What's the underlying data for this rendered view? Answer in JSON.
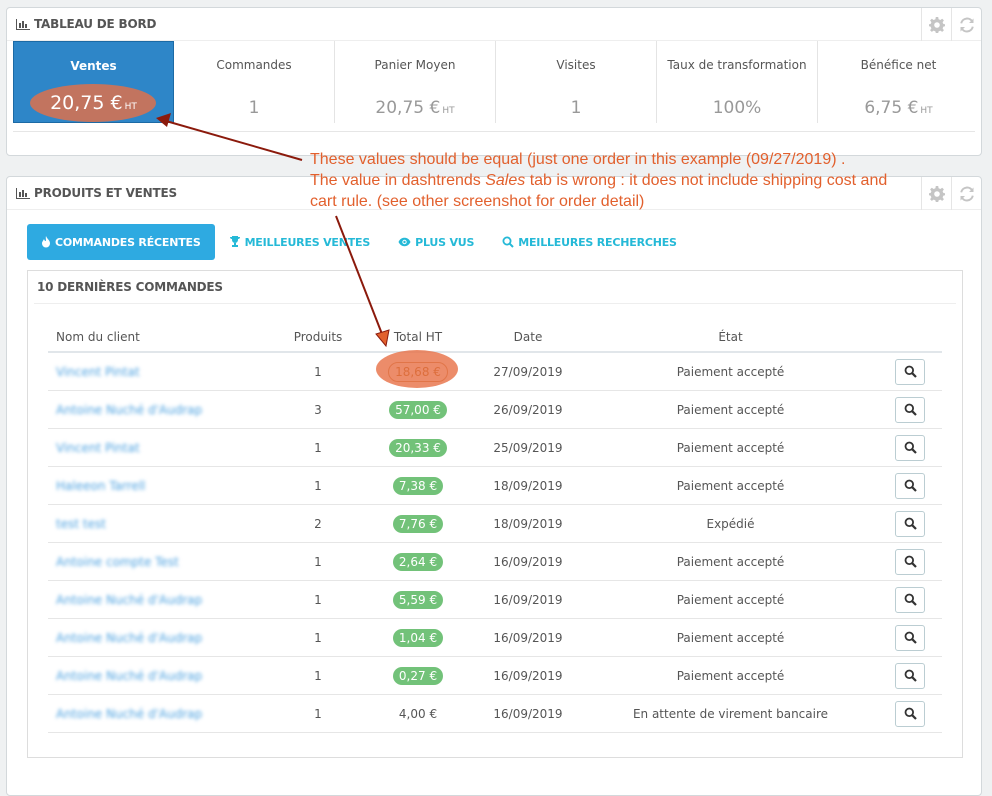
{
  "dashboard": {
    "title": "TABLEAU DE BORD",
    "kpis": [
      {
        "label": "Ventes",
        "value": "20,75 €",
        "unit": "HT",
        "active": true
      },
      {
        "label": "Commandes",
        "value": "1",
        "unit": ""
      },
      {
        "label": "Panier Moyen",
        "value": "20,75 €",
        "unit": "HT"
      },
      {
        "label": "Visites",
        "value": "1",
        "unit": ""
      },
      {
        "label": "Taux de transformation",
        "value": "100%",
        "unit": ""
      },
      {
        "label": "Bénéfice net",
        "value": "6,75 €",
        "unit": "HT"
      }
    ]
  },
  "products": {
    "title": "PRODUITS ET VENTES",
    "tabs": [
      {
        "label": "COMMANDES RÉCENTES",
        "icon": "fire-icon",
        "active": true
      },
      {
        "label": "MEILLEURES VENTES",
        "icon": "trophy-icon"
      },
      {
        "label": "PLUS VUS",
        "icon": "eye-icon"
      },
      {
        "label": "MEILLEURES RECHERCHES",
        "icon": "search-icon"
      }
    ],
    "subpanel_title": "10 DERNIÈRES COMMANDES",
    "columns": [
      "Nom du client",
      "Produits",
      "Total HT",
      "Date",
      "État"
    ],
    "rows": [
      {
        "client": "Vincent Pintat",
        "products": "1",
        "total": "18,68 €",
        "date": "27/09/2019",
        "status": "Paiement accepté",
        "badge": "highlight"
      },
      {
        "client": "Antoine Nuché d'Audrap",
        "products": "3",
        "total": "57,00 €",
        "date": "26/09/2019",
        "status": "Paiement accepté",
        "badge": "green"
      },
      {
        "client": "Vincent Pintat",
        "products": "1",
        "total": "20,33 €",
        "date": "25/09/2019",
        "status": "Paiement accepté",
        "badge": "green"
      },
      {
        "client": "Haleeon Tarrell",
        "products": "1",
        "total": "7,38 €",
        "date": "18/09/2019",
        "status": "Paiement accepté",
        "badge": "green"
      },
      {
        "client": "test test",
        "products": "2",
        "total": "7,76 €",
        "date": "18/09/2019",
        "status": "Expédié",
        "badge": "green"
      },
      {
        "client": "Antoine compte Test",
        "products": "1",
        "total": "2,64 €",
        "date": "16/09/2019",
        "status": "Paiement accepté",
        "badge": "green"
      },
      {
        "client": "Antoine Nuché d'Audrap",
        "products": "1",
        "total": "5,59 €",
        "date": "16/09/2019",
        "status": "Paiement accepté",
        "badge": "green"
      },
      {
        "client": "Antoine Nuché d'Audrap",
        "products": "1",
        "total": "1,04 €",
        "date": "16/09/2019",
        "status": "Paiement accepté",
        "badge": "green"
      },
      {
        "client": "Antoine Nuché d'Audrap",
        "products": "1",
        "total": "0,27 €",
        "date": "16/09/2019",
        "status": "Paiement accepté",
        "badge": "green"
      },
      {
        "client": "Antoine Nuché d'Audrap",
        "products": "1",
        "total": "4,00 €",
        "date": "16/09/2019",
        "status": "En attente de virement bancaire",
        "badge": "plain"
      }
    ]
  },
  "annotation": {
    "line1": "These values should be equal (just one order in this example (09/27/2019) .",
    "line2_a": "The value in dashtrends ",
    "line2_em": "Sales",
    "line2_b": " tab is wrong : it  does not include shipping cost and",
    "line3": "cart rule.  (see other screenshot for order detail)"
  },
  "colors": {
    "accent": "#2eaae1",
    "active_kpi": "#2e86c8",
    "badge_green": "#72c279",
    "annotation": "#e2602d",
    "highlight": "#e76f45"
  },
  "icons": {
    "panel_icon": "bar-chart-icon",
    "tools": [
      "gear-icon",
      "refresh-icon"
    ],
    "row_action": "search-icon"
  }
}
